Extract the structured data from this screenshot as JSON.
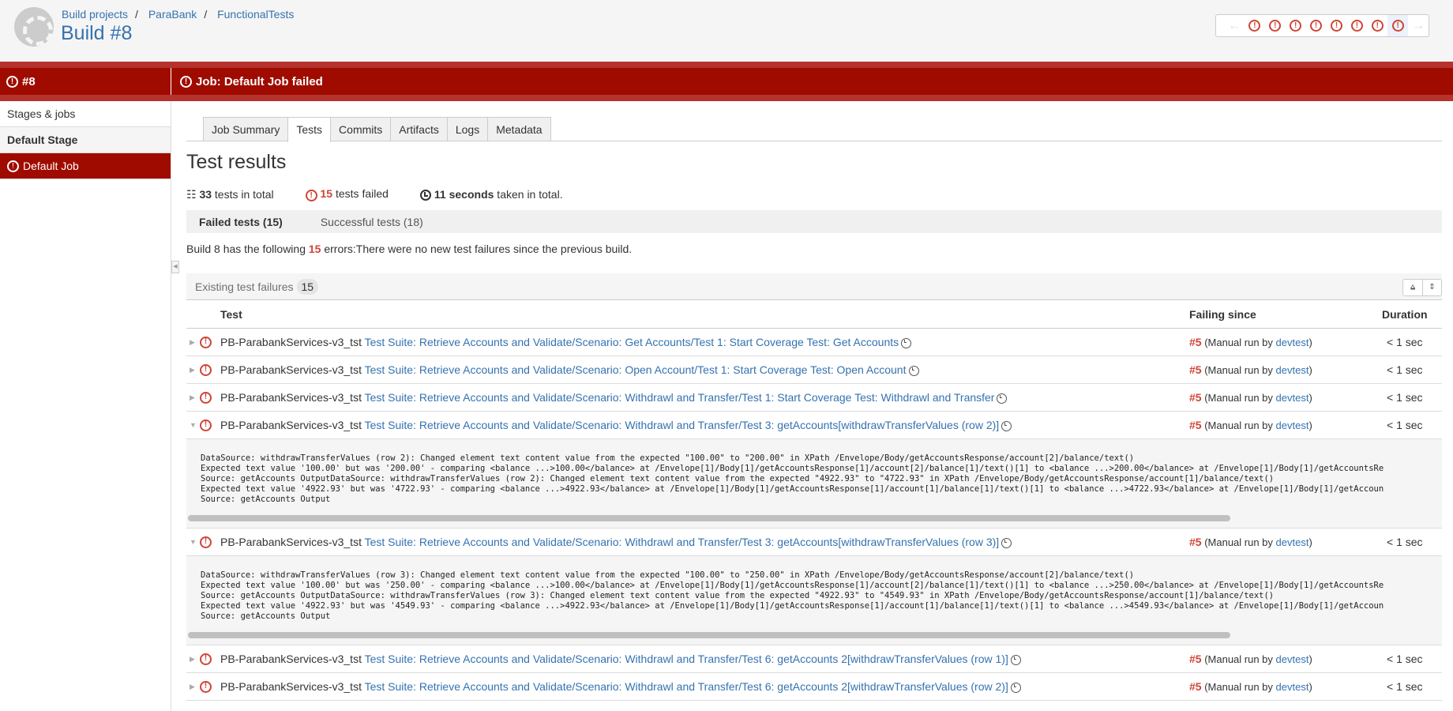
{
  "header": {
    "breadcrumbs": [
      "Build projects",
      "ParaBank",
      "FunctionalTests"
    ],
    "title": "Build #8",
    "nav_count": 8
  },
  "status_bar": {
    "build_label": "#8",
    "job_label": "Job: Default Job failed"
  },
  "sidebar": {
    "items": [
      {
        "label": "Stages & jobs"
      },
      {
        "label": "Default Stage"
      },
      {
        "label": "Default Job"
      }
    ]
  },
  "tabs": [
    "Job Summary",
    "Tests",
    "Commits",
    "Artifacts",
    "Logs",
    "Metadata"
  ],
  "main": {
    "heading": "Test results",
    "stats": {
      "total": "33",
      "total_text": " tests in total",
      "failed": "15",
      "failed_text": " tests failed",
      "time": "11 seconds",
      "time_text": " taken in total."
    },
    "subtabs": [
      "Failed tests (15)",
      "Successful tests (18)"
    ],
    "message": {
      "pre": "Build 8 has the following ",
      "count": "15",
      "post": " errors:There were no new test failures since the previous build."
    },
    "existing": {
      "label": "Existing test failures",
      "count": "15"
    },
    "columns": {
      "test": "Test",
      "failing_since": "Failing since",
      "duration": "Duration"
    },
    "rows": [
      {
        "prefix": "PB-ParabankServices-v3_tst",
        "name": "Test Suite: Retrieve Accounts and Validate/Scenario: Get Accounts/Test 1: Start Coverage Test: Get Accounts",
        "since": "#5",
        "run": "(Manual run by ",
        "user": "devtest",
        "end": ")",
        "duration": "< 1 sec"
      },
      {
        "prefix": "PB-ParabankServices-v3_tst",
        "name": "Test Suite: Retrieve Accounts and Validate/Scenario: Open Account/Test 1: Start Coverage Test: Open Account",
        "since": "#5",
        "run": "(Manual run by ",
        "user": "devtest",
        "end": ")",
        "duration": "< 1 sec"
      },
      {
        "prefix": "PB-ParabankServices-v3_tst",
        "name": "Test Suite: Retrieve Accounts and Validate/Scenario: Withdrawl and Transfer/Test 1: Start Coverage Test: Withdrawl and Transfer",
        "since": "#5",
        "run": "(Manual run by ",
        "user": "devtest",
        "end": ")",
        "duration": "< 1 sec"
      },
      {
        "prefix": "PB-ParabankServices-v3_tst",
        "name": "Test Suite: Retrieve Accounts and Validate/Scenario: Withdrawl and Transfer/Test 3: getAccounts[withdrawTransferValues (row 2)]",
        "since": "#5",
        "run": "(Manual run by ",
        "user": "devtest",
        "end": ")",
        "duration": "< 1 sec",
        "details": "DataSource: withdrawTransferValues (row 2): Changed element text content value from the expected \"100.00\" to \"200.00\" in XPath /Envelope/Body/getAccountsResponse/account[2]/balance/text()\nExpected text value '100.00' but was '200.00' - comparing <balance ...>100.00</balance> at /Envelope[1]/Body[1]/getAccountsResponse[1]/account[2]/balance[1]/text()[1] to <balance ...>200.00</balance> at /Envelope[1]/Body[1]/getAccountsRe\nSource: getAccounts OutputDataSource: withdrawTransferValues (row 2): Changed element text content value from the expected \"4922.93\" to \"4722.93\" in XPath /Envelope/Body/getAccountsResponse/account[1]/balance/text()\nExpected text value '4922.93' but was '4722.93' - comparing <balance ...>4922.93</balance> at /Envelope[1]/Body[1]/getAccountsResponse[1]/account[1]/balance[1]/text()[1] to <balance ...>4722.93</balance> at /Envelope[1]/Body[1]/getAccoun\nSource: getAccounts Output"
      },
      {
        "prefix": "PB-ParabankServices-v3_tst",
        "name": "Test Suite: Retrieve Accounts and Validate/Scenario: Withdrawl and Transfer/Test 3: getAccounts[withdrawTransferValues (row 3)]",
        "since": "#5",
        "run": "(Manual run by ",
        "user": "devtest",
        "end": ")",
        "duration": "< 1 sec",
        "details": "DataSource: withdrawTransferValues (row 3): Changed element text content value from the expected \"100.00\" to \"250.00\" in XPath /Envelope/Body/getAccountsResponse/account[2]/balance/text()\nExpected text value '100.00' but was '250.00' - comparing <balance ...>100.00</balance> at /Envelope[1]/Body[1]/getAccountsResponse[1]/account[2]/balance[1]/text()[1] to <balance ...>250.00</balance> at /Envelope[1]/Body[1]/getAccountsRe\nSource: getAccounts OutputDataSource: withdrawTransferValues (row 3): Changed element text content value from the expected \"4922.93\" to \"4549.93\" in XPath /Envelope/Body/getAccountsResponse/account[1]/balance/text()\nExpected text value '4922.93' but was '4549.93' - comparing <balance ...>4922.93</balance> at /Envelope[1]/Body[1]/getAccountsResponse[1]/account[1]/balance[1]/text()[1] to <balance ...>4549.93</balance> at /Envelope[1]/Body[1]/getAccoun\nSource: getAccounts Output"
      },
      {
        "prefix": "PB-ParabankServices-v3_tst",
        "name": "Test Suite: Retrieve Accounts and Validate/Scenario: Withdrawl and Transfer/Test 6: getAccounts 2[withdrawTransferValues (row 1)]",
        "since": "#5",
        "run": "(Manual run by ",
        "user": "devtest",
        "end": ")",
        "duration": "< 1 sec"
      },
      {
        "prefix": "PB-ParabankServices-v3_tst",
        "name": "Test Suite: Retrieve Accounts and Validate/Scenario: Withdrawl and Transfer/Test 6: getAccounts 2[withdrawTransferValues (row 2)]",
        "since": "#5",
        "run": "(Manual run by ",
        "user": "devtest",
        "end": ")",
        "duration": "< 1 sec"
      }
    ]
  },
  "colors": {
    "accent": "#a00b00",
    "link": "#3572b0",
    "error": "#d04437"
  }
}
